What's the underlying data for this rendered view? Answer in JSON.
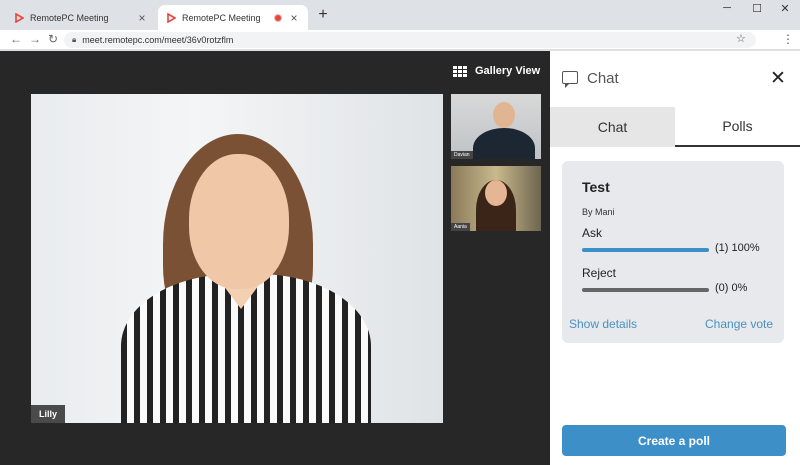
{
  "browser": {
    "tabs": [
      {
        "title": "RemotePC Meeting",
        "active": false
      },
      {
        "title": "RemotePC Meeting",
        "active": true,
        "recording": true
      }
    ],
    "url": "meet.remotepc.com/meet/36v0rotzflm",
    "colors": {
      "rec": "#e8453c",
      "favicon": "#e8453c"
    }
  },
  "meeting": {
    "gallery_view_label": "Gallery View",
    "main_participant": "Lilly",
    "thumbnails": [
      {
        "name": "Davian"
      },
      {
        "name": "Aania"
      }
    ]
  },
  "panel": {
    "title": "Chat",
    "tabs": [
      {
        "label": "Chat",
        "active": false
      },
      {
        "label": "Polls",
        "active": true
      }
    ],
    "poll": {
      "title": "Test",
      "author": "By Mani",
      "options": [
        {
          "label": "Ask",
          "count": "(1) 100%",
          "fraction": 1.0,
          "color": "#3d8fc8"
        },
        {
          "label": "Reject",
          "count": "(0) 0%",
          "fraction": 0.0,
          "color": "#666666"
        }
      ],
      "show_details": "Show details",
      "change_vote": "Change vote"
    },
    "create_poll": "Create a poll"
  }
}
